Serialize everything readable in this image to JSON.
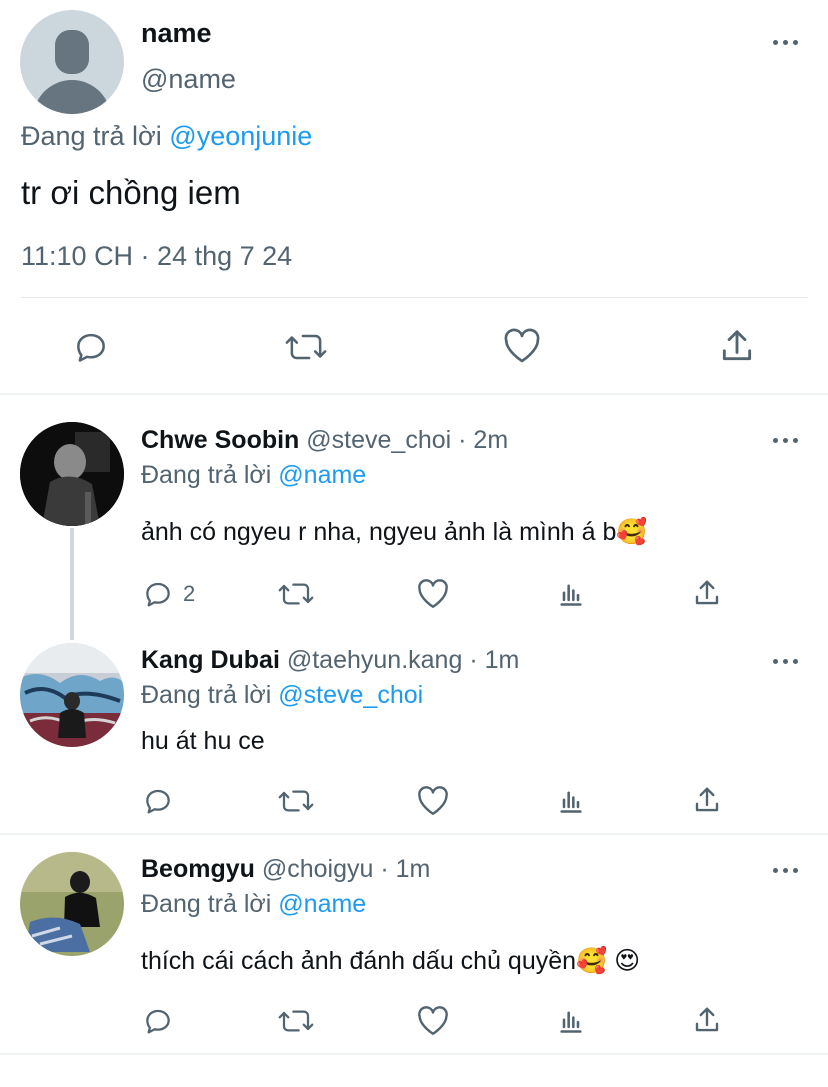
{
  "main_tweet": {
    "display_name": "name",
    "handle": "@name",
    "replying_prefix": "Đang trả lời",
    "replying_to": "@yeonjunie",
    "text": "tr ơi chồng iem",
    "timestamp": "11:10 CH · 24 thg 7 24"
  },
  "replies": [
    {
      "display_name": "Chwe Soobin",
      "handle": "@steve_choi",
      "time": "· 2m",
      "replying_prefix": "Đang trả lời",
      "replying_to": "@name",
      "text": "ảnh có ngyeu r nha, ngyeu ảnh là mình á b🥰",
      "reply_count": "2"
    },
    {
      "display_name": "Kang Dubai",
      "handle": "@taehyun.kang",
      "time": "· 1m",
      "replying_prefix": "Đang trả lời",
      "replying_to": "@steve_choi",
      "text": "hu át hu ce",
      "reply_count": ""
    },
    {
      "display_name": "Beomgyu",
      "handle": "@choigyu",
      "time": "· 1m",
      "replying_prefix": "Đang trả lời",
      "replying_to": "@name",
      "text": "thích cái cách ảnh đánh dấu chủ quyền🥰 😍",
      "reply_count": ""
    }
  ],
  "icons": {
    "reply": "reply-icon",
    "retweet": "retweet-icon",
    "like": "like-icon",
    "share": "share-icon",
    "analytics": "analytics-icon",
    "more": "more-icon"
  },
  "colors": {
    "accent": "#1d9bf0",
    "muted": "#536471",
    "text": "#0f1419"
  }
}
